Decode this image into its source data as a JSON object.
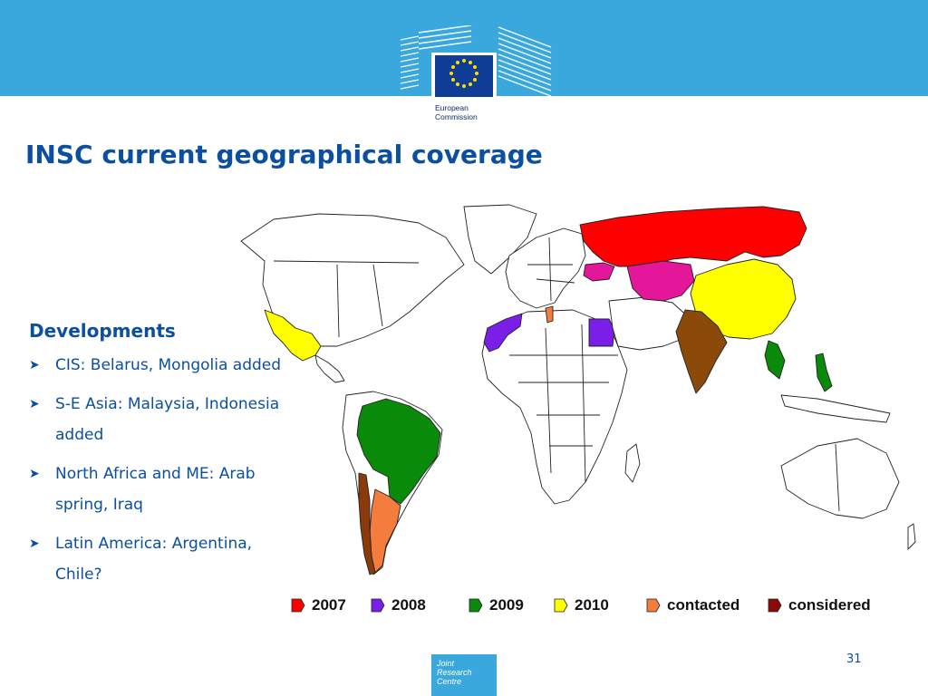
{
  "header": {
    "logo_line1": "European",
    "logo_line2": "Commission"
  },
  "slide": {
    "title": "INSC current geographical coverage",
    "page_number": "31"
  },
  "developments": {
    "heading": "Developments",
    "items": [
      "CIS: Belarus, Mongolia added",
      "S-E Asia: Malaysia, Indonesia added",
      "North Africa and ME: Arab spring, Iraq",
      "Latin America: Argentina, Chile?"
    ]
  },
  "map": {
    "legend": [
      {
        "label": "2007",
        "color": "#ff0000"
      },
      {
        "label": "2008",
        "color": "#7a1ee8"
      },
      {
        "label": "2009",
        "color": "#0a8a0a"
      },
      {
        "label": "2010",
        "color": "#ffff00"
      },
      {
        "label": "contacted",
        "color": "#f47c3c"
      },
      {
        "label": "considered",
        "color": "#8b0a0a"
      }
    ]
  },
  "footer": {
    "jrc_line1": "Joint",
    "jrc_line2": "Research",
    "jrc_line3": "Centre"
  }
}
